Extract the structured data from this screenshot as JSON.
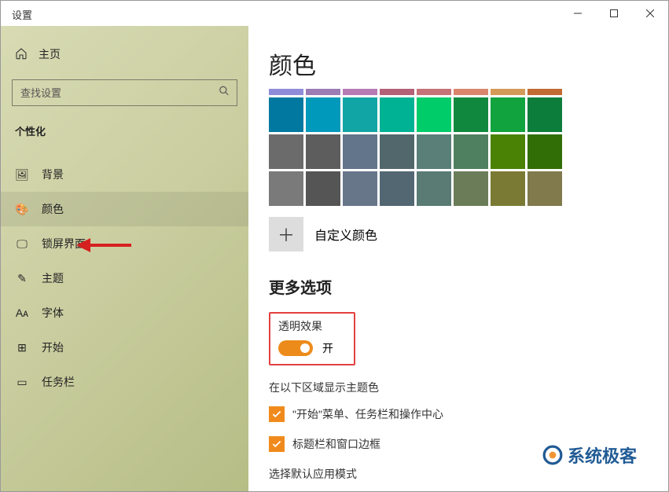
{
  "window_title": "设置",
  "sidebar": {
    "home": "主页",
    "search_placeholder": "查找设置",
    "section": "个性化",
    "items": [
      {
        "icon": "image-icon",
        "glyph": "🖼",
        "label": "背景"
      },
      {
        "icon": "palette-icon",
        "glyph": "🎨",
        "label": "颜色",
        "selected": true
      },
      {
        "icon": "lock-screen-icon",
        "glyph": "🖵",
        "label": "锁屏界面"
      },
      {
        "icon": "theme-icon",
        "glyph": "✎",
        "label": "主题"
      },
      {
        "icon": "font-icon",
        "glyph": "Aᴀ",
        "label": "字体"
      },
      {
        "icon": "start-icon",
        "glyph": "⊞",
        "label": "开始"
      },
      {
        "icon": "taskbar-icon",
        "glyph": "▭",
        "label": "任务栏"
      }
    ]
  },
  "main": {
    "page_title": "颜色",
    "strip_colors": [
      "#8e8cd8",
      "#9b7cb4",
      "#b67bb4",
      "#b46178",
      "#c67378",
      "#d9866d",
      "#d49a57",
      "#c16a32"
    ],
    "swatch_rows": [
      [
        "#0078a0",
        "#0099bc",
        "#12a5a5",
        "#00b294",
        "#00cc6a",
        "#10893e",
        "#10a33e",
        "#0d7d3b"
      ],
      [
        "#6b6b6b",
        "#5d5d5d",
        "#62758a",
        "#52676c",
        "#5a7f78",
        "#4f8060",
        "#498205",
        "#316e06"
      ],
      [
        "#7a7a7a",
        "#555555",
        "#68768a",
        "#536773",
        "#597b74",
        "#6a7d58",
        "#7a7a35",
        "#807a4d"
      ]
    ],
    "custom_color_label": "自定义颜色",
    "more_options": "更多选项",
    "transparency": {
      "label": "透明效果",
      "state_text": "开",
      "on": true
    },
    "accent_areas": {
      "label": "在以下区域显示主题色",
      "opt1": "\"开始\"菜单、任务栏和操作中心",
      "opt2": "标题栏和窗口边框"
    },
    "default_mode_label": "选择默认应用模式"
  },
  "watermark": "系统极客"
}
